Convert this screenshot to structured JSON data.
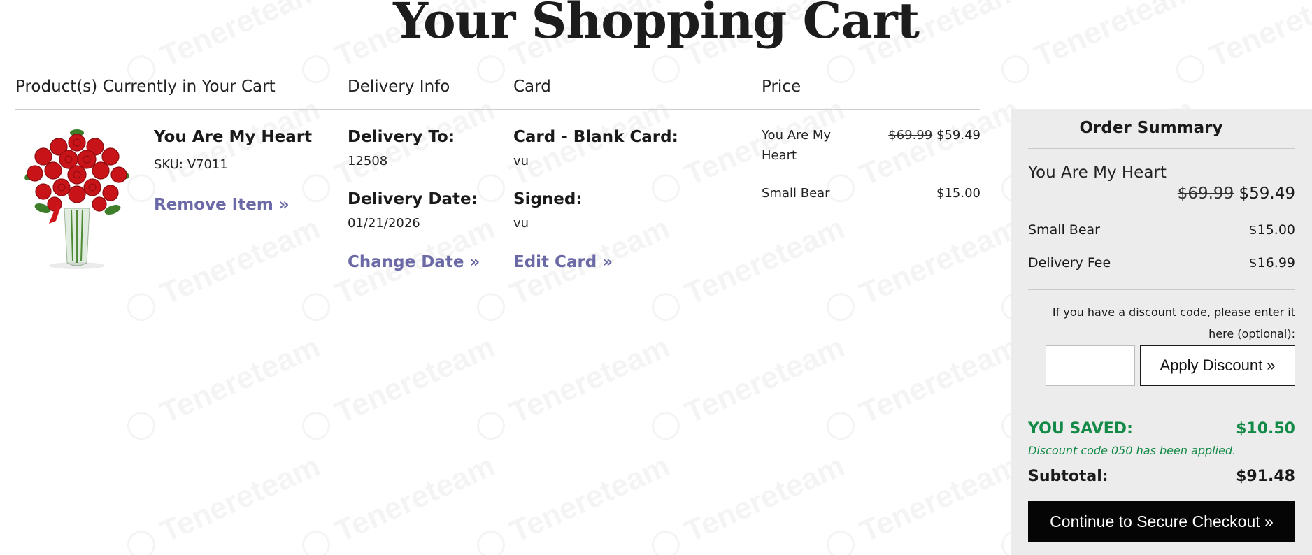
{
  "page": {
    "title": "Your Shopping Cart"
  },
  "watermark": {
    "text": "Tenereteam"
  },
  "columns": {
    "products": "Product(s) Currently in Your Cart",
    "delivery": "Delivery Info",
    "card": "Card",
    "price": "Price"
  },
  "item": {
    "name": "You Are My Heart",
    "sku": "SKU: V7011",
    "remove_link": "Remove Item »",
    "image_icon": "red-roses-bouquet"
  },
  "delivery": {
    "to_label": "Delivery To:",
    "to_value": "12508",
    "date_label": "Delivery Date:",
    "date_value": "01/21/2026",
    "change_link": "Change Date »"
  },
  "card": {
    "type_label": "Card - Blank Card:",
    "type_value": "vu",
    "signed_label": "Signed:",
    "signed_value": "vu",
    "edit_link": "Edit Card »"
  },
  "price": {
    "line1_name": "You Are My Heart",
    "line1_old": "$69.99",
    "line1_new": "$59.49",
    "line2_name": "Small Bear",
    "line2_price": "$15.00"
  },
  "summary": {
    "title": "Order Summary",
    "item_name": "You Are My Heart",
    "item_old_price": "$69.99",
    "item_new_price": "$59.49",
    "bear_label": "Small Bear",
    "bear_price": "$15.00",
    "fee_label": "Delivery Fee",
    "fee_price": "$16.99",
    "discount_note": "If you have a discount code, please enter it here (optional):",
    "discount_placeholder": "",
    "apply_label": "Apply Discount »",
    "saved_label": "YOU SAVED:",
    "saved_value": "$10.50",
    "applied_note": "Discount code 050 has been applied.",
    "subtotal_label": "Subtotal:",
    "subtotal_value": "$91.48",
    "checkout_label": "Continue to Secure Checkout »"
  },
  "colors": {
    "link": "#6b6aa6",
    "saved_green": "#138a47",
    "summary_bg": "#ececec",
    "checkout_bg": "#050505"
  }
}
